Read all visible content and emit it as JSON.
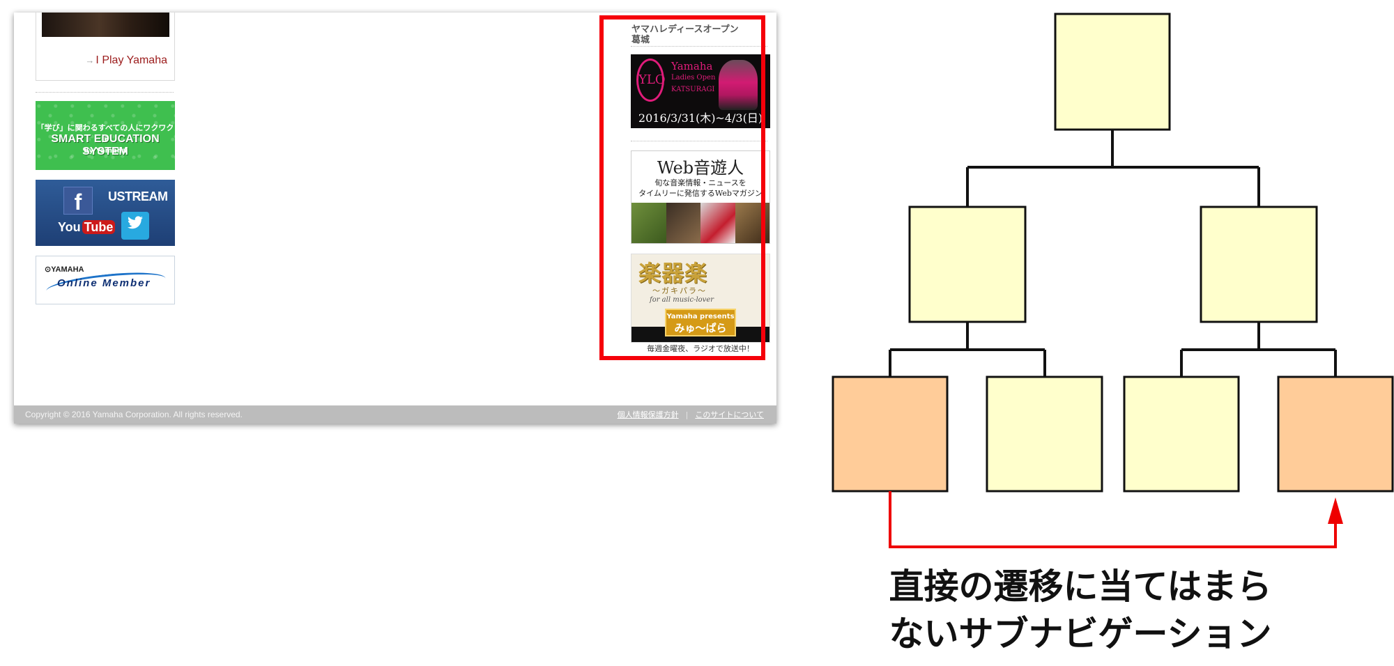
{
  "site": {
    "card_link": "I Play Yamaha",
    "banners": {
      "smart_education": {
        "line1": "「学び」に関わるすべての人にワクワクを",
        "line2": "SMART EDUCATION SYSTEM",
        "line3": "by Yamaha"
      },
      "social": {
        "facebook": "f",
        "ustream": "USTREAM",
        "youtube_you": "You",
        "youtube_tube": "Tube"
      },
      "member": {
        "brand": "⊙YAMAHA",
        "label": "Online Member"
      }
    },
    "right_panel": {
      "title_line1": "ヤマハレディースオープン",
      "title_line2": "葛城",
      "ladies_ad": {
        "logo": "YLO",
        "name": "Yamaha",
        "subtitle": "Ladies Open",
        "place": "KATSURAGI",
        "dates": "2016/3/31(木)~4/3(日)"
      },
      "web_ad": {
        "title": "Web音遊人",
        "sub1": "旬な音楽情報・ニュースを",
        "sub2": "タイムリーに発信するWebマガジン"
      },
      "gakki_ad": {
        "title": "楽器楽",
        "subtitle": "〜ガキパラ〜",
        "tagline": "for all music-lover",
        "badge_top": "Yamaha presents",
        "badge_main": "みゅ〜ぱら",
        "caption": "毎週金曜夜、ラジオで放送中！"
      }
    },
    "footer": {
      "copyright": "Copyright © 2016 Yamaha Corporation. All rights reserved.",
      "privacy": "個人情報保護方針",
      "about": "このサイトについて"
    }
  },
  "diagram": {
    "caption_line1": "直接の遷移に当てはまら",
    "caption_line2": "ないサブナビゲーション",
    "colors": {
      "node": "#ffffcc",
      "highlight": "#ffcc99",
      "arrow": "#ee0000",
      "frame": "#f5000a"
    }
  }
}
